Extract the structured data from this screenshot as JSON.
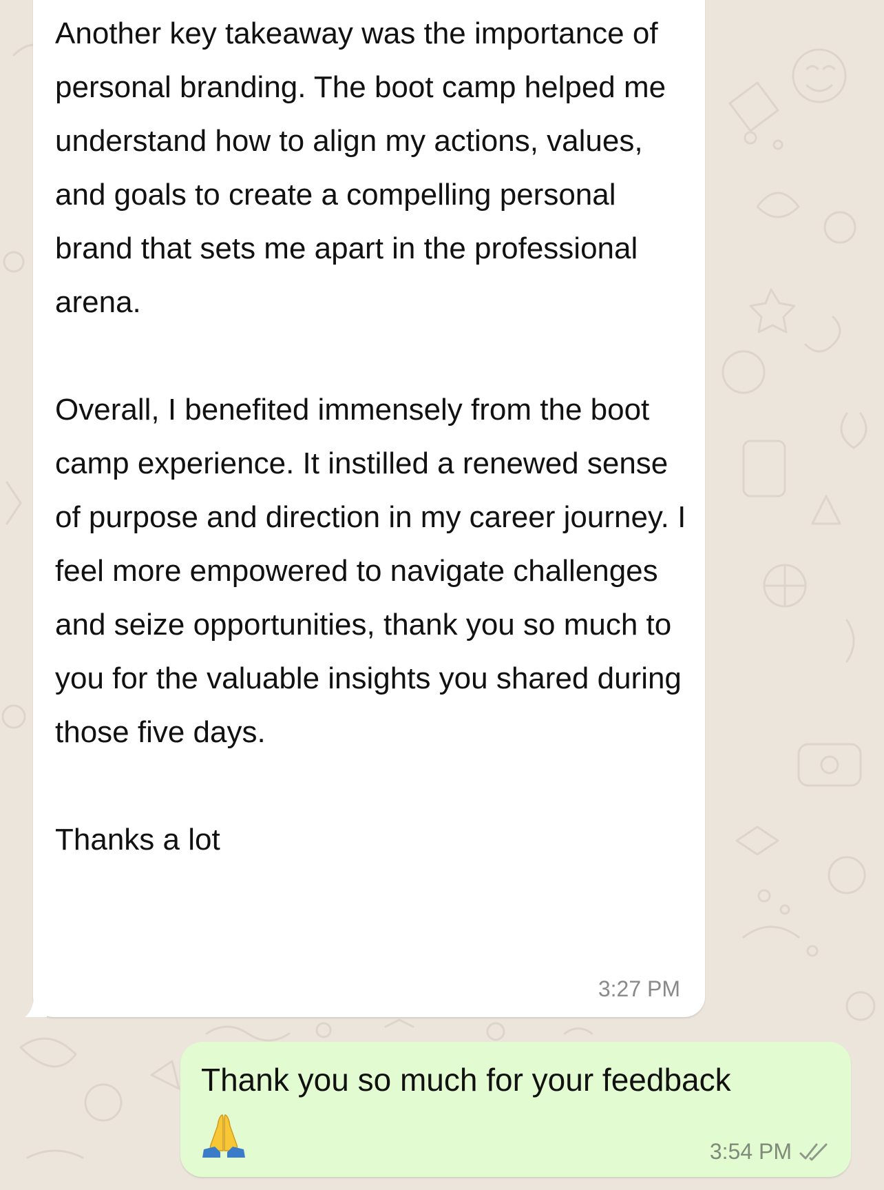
{
  "incoming_message": {
    "text": "Another key takeaway was the importance of personal branding. The boot camp helped me understand how to align my actions, values, and goals to create a compelling personal brand that sets me apart in the professional arena.\n\nOverall, I benefited immensely from the boot camp experience. It instilled a renewed sense of purpose and direction in my career journey. I feel more empowered to navigate challenges and seize opportunities, thank you  so much to you for the valuable insights you shared during those five days.\n\nThanks a lot",
    "time": "3:27 PM"
  },
  "outgoing_message": {
    "text": "Thank you so much for your feedback",
    "emoji": "folded-hands-emoji",
    "time": "3:54 PM",
    "status_icon": "double-check-icon"
  },
  "colors": {
    "wallpaper": "#ece5dc",
    "incoming_bubble": "#ffffff",
    "outgoing_bubble": "#e2fbd0",
    "timestamp": "#8a8a8a",
    "emoji_yellow": "#f7c736",
    "emoji_blue": "#3b7cc9"
  }
}
